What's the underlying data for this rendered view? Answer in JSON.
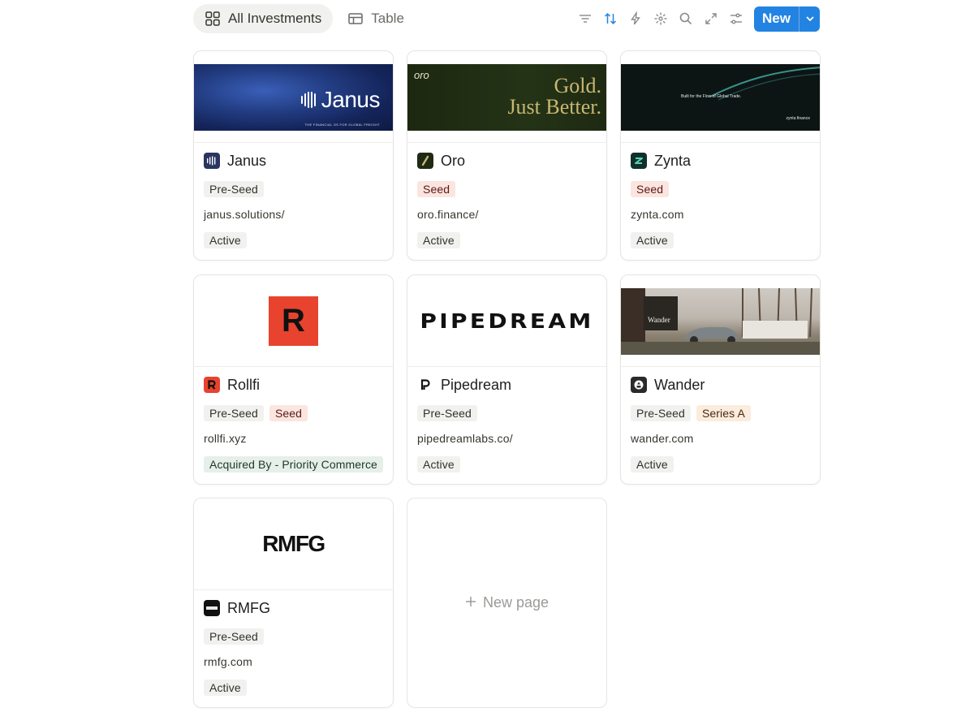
{
  "toolbar": {
    "views": [
      {
        "label": "All Investments",
        "icon": "gallery-icon",
        "active": true
      },
      {
        "label": "Table",
        "icon": "table-icon",
        "active": false
      }
    ],
    "tools": [
      "filter-icon",
      "sort-icon",
      "automation-icon",
      "customize-icon",
      "search-icon",
      "expand-icon",
      "settings-icon"
    ],
    "new_label": "New"
  },
  "cards": [
    {
      "title": "Janus",
      "tags": [
        {
          "label": "Pre-Seed",
          "color": "gray"
        }
      ],
      "url": "janus.solutions/",
      "status": {
        "label": "Active",
        "color": "gray"
      },
      "cover_text": "Janus",
      "cover_subtext": "THE FINANCIAL OS FOR GLOBAL FREIGHT"
    },
    {
      "title": "Oro",
      "tags": [
        {
          "label": "Seed",
          "color": "red"
        }
      ],
      "url": "oro.finance/",
      "status": {
        "label": "Active",
        "color": "gray"
      },
      "cover_text": "Gold.",
      "cover_text2": "Just Better.",
      "cover_brand": "oro"
    },
    {
      "title": "Zynta",
      "tags": [
        {
          "label": "Seed",
          "color": "red"
        }
      ],
      "url": "zynta.com",
      "status": {
        "label": "Active",
        "color": "gray"
      },
      "cover_text": "Built for the Flow of Global Trade.",
      "cover_brand": "zynta finance"
    },
    {
      "title": "Rollfi",
      "tags": [
        {
          "label": "Pre-Seed",
          "color": "gray"
        },
        {
          "label": "Seed",
          "color": "red"
        }
      ],
      "url": "rollfi.xyz",
      "status": {
        "label": "Acquired By - Priority Commerce",
        "color": "green"
      },
      "cover_text": "R"
    },
    {
      "title": "Pipedream",
      "tags": [
        {
          "label": "Pre-Seed",
          "color": "gray"
        }
      ],
      "url": "pipedreamlabs.co/",
      "status": {
        "label": "Active",
        "color": "gray"
      },
      "cover_text": "PIPEDREAM"
    },
    {
      "title": "Wander",
      "tags": [
        {
          "label": "Pre-Seed",
          "color": "gray"
        },
        {
          "label": "Series A",
          "color": "orange"
        }
      ],
      "url": "wander.com",
      "status": {
        "label": "Active",
        "color": "gray"
      },
      "cover_text": "Wander"
    },
    {
      "title": "RMFG",
      "tags": [
        {
          "label": "Pre-Seed",
          "color": "gray"
        }
      ],
      "url": "rmfg.com",
      "status": {
        "label": "Active",
        "color": "gray"
      },
      "cover_text": "RMFG"
    }
  ],
  "new_page_label": "New page",
  "colors": {
    "accent": "#2383e2",
    "rollfi_red": "#e8432e",
    "oro_bg": "#1f2a14",
    "oro_gold": "#c9b772"
  }
}
